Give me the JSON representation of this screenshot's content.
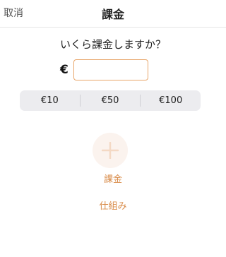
{
  "header": {
    "cancel_label": "取消",
    "title": "課金"
  },
  "main": {
    "question": "いくら課金しますか？",
    "currency_symbol": "€",
    "amount_value": "",
    "presets": [
      "€10",
      "€50",
      "€100"
    ],
    "add_label": "課金",
    "how_label": "仕組み",
    "add_icon": "plus-icon"
  },
  "colors": {
    "accent": "#d98c4a",
    "input_border": "#e8a66a",
    "segment_bg": "#ececef",
    "add_circle_bg": "#fbf3ee"
  }
}
